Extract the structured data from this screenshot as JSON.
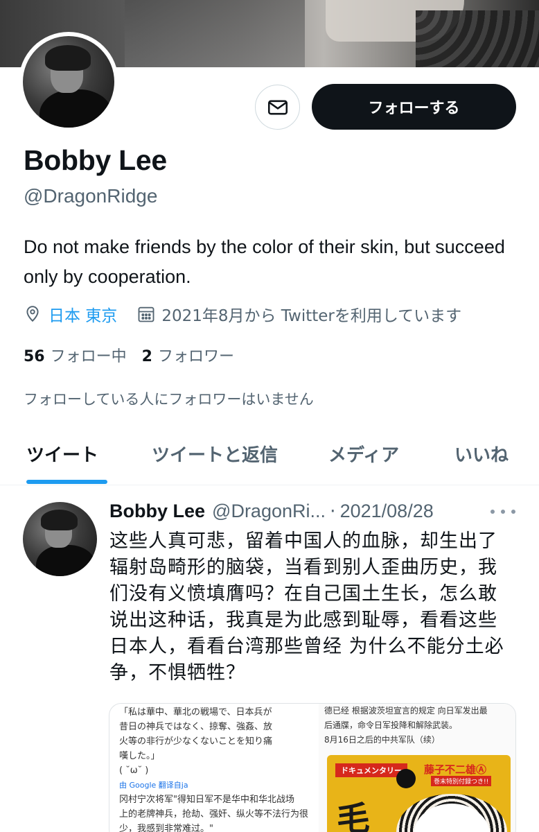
{
  "profile": {
    "name": "Bobby Lee",
    "handle": "@DragonRidge",
    "bio": "Do not make friends by the color of their skin, but succeed only by cooperation.",
    "location": "日本 東京",
    "joined": "2021年8月から Twitterを利用しています",
    "following_count": "56",
    "following_label": "フォロー中",
    "followers_count": "2",
    "followers_label": "フォロワー",
    "followers_note": "フォローしている人にフォロワーはいません",
    "follow_button": "フォローする",
    "message_icon": "envelope-icon"
  },
  "tabs": [
    {
      "label": "ツイート",
      "active": true
    },
    {
      "label": "ツイートと返信",
      "active": false
    },
    {
      "label": "メディア",
      "active": false
    },
    {
      "label": "いいね",
      "active": false
    }
  ],
  "tweet": {
    "name": "Bobby Lee",
    "handle": "@DragonRi...",
    "separator": "·",
    "date": "2021/08/28",
    "text": "这些人真可悲，留着中国人的血脉，却生出了辐射岛畸形的脑袋，当看到别人歪曲历史，我们没有义愤填膺吗？在自己国土生长，怎么敢说出这种话，我真是为此感到耻辱，看看这些日本人，看看台湾那些曾经 为什么不能分土必争，不惧牺牲？",
    "media": {
      "left_lines": [
        "「私は華中、華北の戦場で、日本兵が",
        "昔日の神兵ではなく、掠奪、強姦、放",
        "火等の非行が少なくないことを知り痛",
        "嘆した。」",
        "( ˘ω˘ )",
        "冈村宁次将军\"得知日军不是华中和华北战场",
        "上的老牌神兵，抢劫、强奸、纵火等不法行为很",
        "少，我感到非常难过。\""
      ],
      "google_label": "由 Google 翻译自ja",
      "right_lines": [
        "德已经  根据波茨坦宣言的规定  向日军发出最",
        "后通牒，命令日军投降和解除武装。",
        "8月16日之后的中共军队（续）"
      ],
      "poster_tag": "ドキュメンタリー",
      "poster_author": "藤子不二雄Ⓐ",
      "poster_sub": "巻末特別付録つき!!",
      "poster_big": "毛"
    }
  },
  "colors": {
    "accent": "#1d9bf0",
    "text": "#0f1419",
    "secondary": "#536471",
    "button": "#0f1419"
  }
}
